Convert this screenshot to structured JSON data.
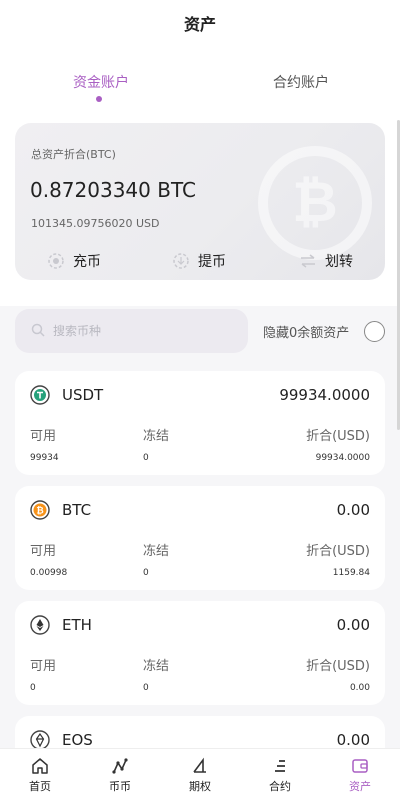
{
  "header": {
    "title": "资产"
  },
  "tabs": [
    {
      "label": "资金账户"
    },
    {
      "label": "合约账户"
    }
  ],
  "asset_card": {
    "label": "总资产折合(BTC)",
    "btc_amount": "0.87203340 BTC",
    "usd_amount": "101345.09756020 USD",
    "actions": [
      {
        "label": "充币"
      },
      {
        "label": "提币"
      },
      {
        "label": "划转"
      }
    ]
  },
  "search": {
    "placeholder": "搜索币种"
  },
  "hide_zero": {
    "label": "隐藏0余额资产"
  },
  "columns": {
    "available": "可用",
    "frozen": "冻结",
    "converted": "折合(USD)"
  },
  "coins": [
    {
      "name": "USDT",
      "total": "99934.0000",
      "available": "99934",
      "frozen": "0",
      "converted": "99934.0000"
    },
    {
      "name": "BTC",
      "total": "0.00",
      "available": "0.00998",
      "frozen": "0",
      "converted": "1159.84"
    },
    {
      "name": "ETH",
      "total": "0.00",
      "available": "0",
      "frozen": "0",
      "converted": "0.00"
    },
    {
      "name": "EOS",
      "total": "0.00"
    }
  ],
  "tabbar": [
    {
      "label": "首页"
    },
    {
      "label": "币币"
    },
    {
      "label": "期权"
    },
    {
      "label": "合约"
    },
    {
      "label": "资产"
    }
  ],
  "colors": {
    "accent": "#a95fc3",
    "usdt": "#26a17b",
    "btc": "#f7931a"
  }
}
